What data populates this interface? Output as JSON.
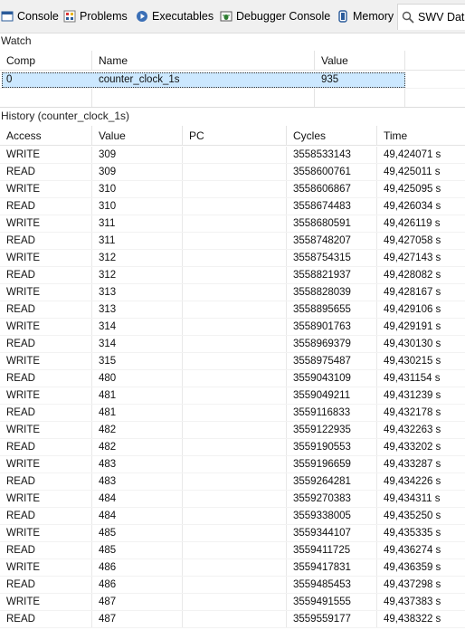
{
  "tabs": [
    {
      "label": "Console",
      "icon": "console-icon",
      "active": false
    },
    {
      "label": "Problems",
      "icon": "problems-icon",
      "active": false
    },
    {
      "label": "Executables",
      "icon": "executables-icon",
      "active": false
    },
    {
      "label": "Debugger Console",
      "icon": "debugger-console-icon",
      "active": false
    },
    {
      "label": "Memory",
      "icon": "memory-icon",
      "active": false
    },
    {
      "label": "SWV Data",
      "icon": "swv-data-icon",
      "active": true
    }
  ],
  "watch": {
    "title": "Watch",
    "columns": [
      "Comp",
      "Name",
      "Value"
    ],
    "rows": [
      {
        "comp": "0",
        "name": "counter_clock_1s",
        "value": "935"
      }
    ]
  },
  "history": {
    "title": "History (counter_clock_1s)",
    "columns": [
      "Access",
      "Value",
      "PC",
      "Cycles",
      "Time"
    ],
    "rows": [
      {
        "access": "WRITE",
        "value": "309",
        "pc": "",
        "cycles": "3558533143",
        "time": "49,424071 s"
      },
      {
        "access": "READ",
        "value": "309",
        "pc": "",
        "cycles": "3558600761",
        "time": "49,425011 s"
      },
      {
        "access": "WRITE",
        "value": "310",
        "pc": "",
        "cycles": "3558606867",
        "time": "49,425095 s"
      },
      {
        "access": "READ",
        "value": "310",
        "pc": "",
        "cycles": "3558674483",
        "time": "49,426034 s"
      },
      {
        "access": "WRITE",
        "value": "311",
        "pc": "",
        "cycles": "3558680591",
        "time": "49,426119 s"
      },
      {
        "access": "READ",
        "value": "311",
        "pc": "",
        "cycles": "3558748207",
        "time": "49,427058 s"
      },
      {
        "access": "WRITE",
        "value": "312",
        "pc": "",
        "cycles": "3558754315",
        "time": "49,427143 s"
      },
      {
        "access": "READ",
        "value": "312",
        "pc": "",
        "cycles": "3558821937",
        "time": "49,428082 s"
      },
      {
        "access": "WRITE",
        "value": "313",
        "pc": "",
        "cycles": "3558828039",
        "time": "49,428167 s"
      },
      {
        "access": "READ",
        "value": "313",
        "pc": "",
        "cycles": "3558895655",
        "time": "49,429106 s"
      },
      {
        "access": "WRITE",
        "value": "314",
        "pc": "",
        "cycles": "3558901763",
        "time": "49,429191 s"
      },
      {
        "access": "READ",
        "value": "314",
        "pc": "",
        "cycles": "3558969379",
        "time": "49,430130 s"
      },
      {
        "access": "WRITE",
        "value": "315",
        "pc": "",
        "cycles": "3558975487",
        "time": "49,430215 s"
      },
      {
        "access": "READ",
        "value": "480",
        "pc": "",
        "cycles": "3559043109",
        "time": "49,431154 s"
      },
      {
        "access": "WRITE",
        "value": "481",
        "pc": "",
        "cycles": "3559049211",
        "time": "49,431239 s"
      },
      {
        "access": "READ",
        "value": "481",
        "pc": "",
        "cycles": "3559116833",
        "time": "49,432178 s"
      },
      {
        "access": "WRITE",
        "value": "482",
        "pc": "",
        "cycles": "3559122935",
        "time": "49,432263 s"
      },
      {
        "access": "READ",
        "value": "482",
        "pc": "",
        "cycles": "3559190553",
        "time": "49,433202 s"
      },
      {
        "access": "WRITE",
        "value": "483",
        "pc": "",
        "cycles": "3559196659",
        "time": "49,433287 s"
      },
      {
        "access": "READ",
        "value": "483",
        "pc": "",
        "cycles": "3559264281",
        "time": "49,434226 s"
      },
      {
        "access": "WRITE",
        "value": "484",
        "pc": "",
        "cycles": "3559270383",
        "time": "49,434311 s"
      },
      {
        "access": "READ",
        "value": "484",
        "pc": "",
        "cycles": "3559338005",
        "time": "49,435250 s"
      },
      {
        "access": "WRITE",
        "value": "485",
        "pc": "",
        "cycles": "3559344107",
        "time": "49,435335 s"
      },
      {
        "access": "READ",
        "value": "485",
        "pc": "",
        "cycles": "3559411725",
        "time": "49,436274 s"
      },
      {
        "access": "WRITE",
        "value": "486",
        "pc": "",
        "cycles": "3559417831",
        "time": "49,436359 s"
      },
      {
        "access": "READ",
        "value": "486",
        "pc": "",
        "cycles": "3559485453",
        "time": "49,437298 s"
      },
      {
        "access": "WRITE",
        "value": "487",
        "pc": "",
        "cycles": "3559491555",
        "time": "49,437383 s"
      },
      {
        "access": "READ",
        "value": "487",
        "pc": "",
        "cycles": "3559559177",
        "time": "49,438322 s"
      }
    ]
  }
}
